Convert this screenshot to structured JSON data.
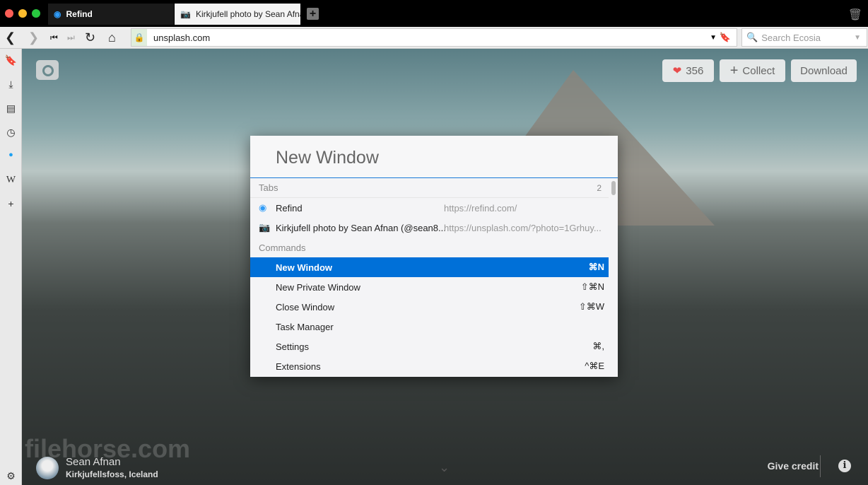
{
  "tabs": [
    {
      "title": "Refind"
    },
    {
      "title": "Kirkjufell photo by Sean Afnan"
    }
  ],
  "toolbar": {
    "url": "unsplash.com",
    "search_placeholder": "Search Ecosia"
  },
  "photo": {
    "likes": "356",
    "collect_label": "Collect",
    "download_label": "Download",
    "author": "Sean Afnan",
    "location": "Kirkjufellsfoss, Iceland",
    "give_credit": "Give credit",
    "watermark": "filehorse.com"
  },
  "palette": {
    "query": "New Window",
    "tabs_section": "Tabs",
    "tabs_count": "2",
    "tab_results": [
      {
        "title": "Refind",
        "url": "https://refind.com/"
      },
      {
        "title": "Kirkjufell photo by Sean Afnan (@sean8...",
        "url": "https://unsplash.com/?photo=1Grhuy..."
      }
    ],
    "commands_section": "Commands",
    "commands": [
      {
        "label": "New Window",
        "shortcut": "⌘N"
      },
      {
        "label": "New Private Window",
        "shortcut": "⇧⌘N"
      },
      {
        "label": "Close Window",
        "shortcut": "⇧⌘W"
      },
      {
        "label": "Task Manager",
        "shortcut": ""
      },
      {
        "label": "Settings",
        "shortcut": "⌘,"
      },
      {
        "label": "Extensions",
        "shortcut": "^⌘E"
      }
    ]
  },
  "colors": {
    "accent": "#0070d8",
    "heart": "#e84c4c"
  }
}
